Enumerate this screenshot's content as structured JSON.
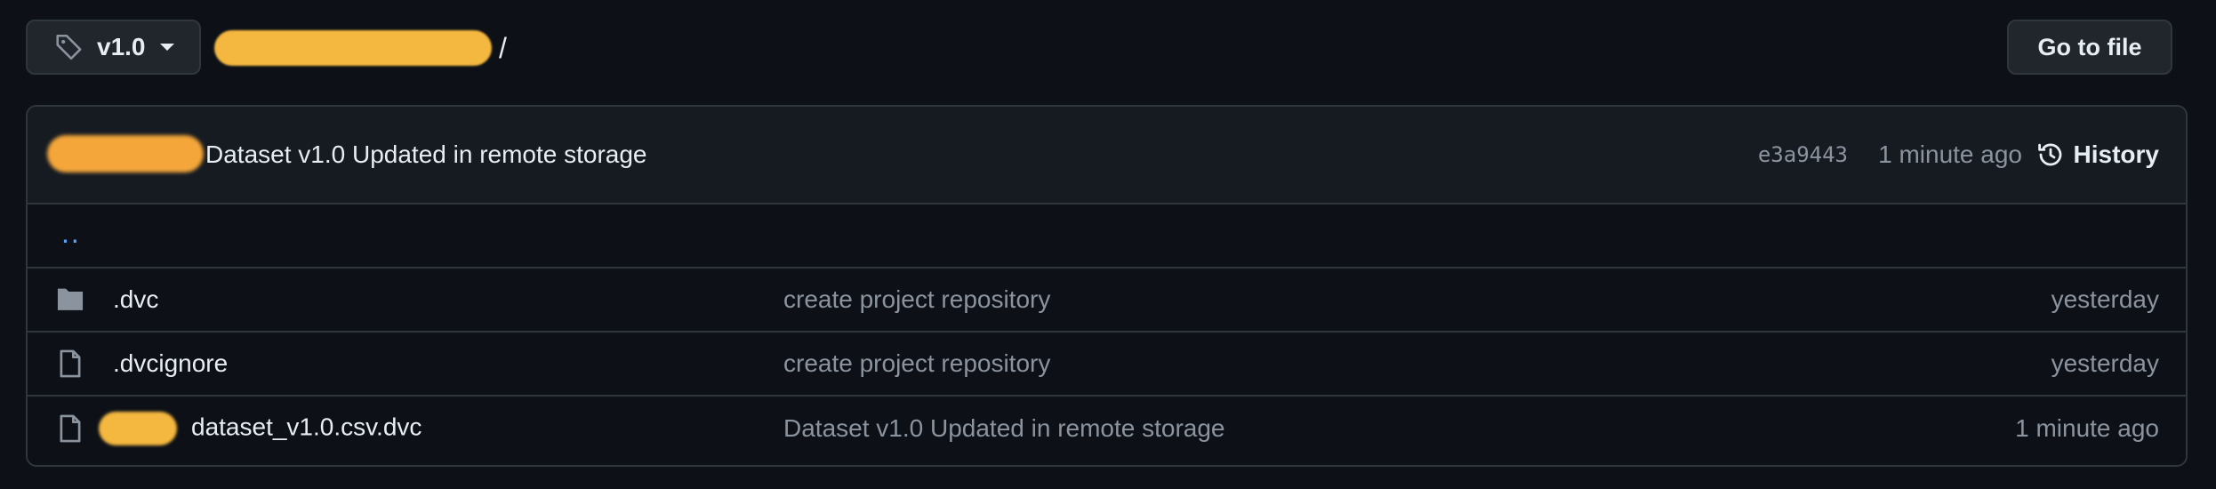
{
  "branch": {
    "label": "v1.0"
  },
  "path": {
    "separator": "/"
  },
  "goto_button": "Go to file",
  "latest_commit": {
    "message": "Dataset v1.0 Updated in remote storage",
    "sha": "e3a9443",
    "time": "1 minute ago",
    "history_label": "History"
  },
  "parent_link": "..",
  "files": [
    {
      "type": "folder",
      "name": ".dvc",
      "commit": "create project repository",
      "date": "yesterday"
    },
    {
      "type": "file",
      "name": ".dvcignore",
      "commit": "create project repository",
      "date": "yesterday"
    },
    {
      "type": "file",
      "name": "dataset_v1.0.csv.dvc",
      "commit": "Dataset v1.0 Updated in remote storage",
      "date": "1 minute ago"
    }
  ],
  "colors": {
    "background": "#0d1117",
    "border": "#30363d",
    "link": "#58a6ff",
    "muted": "#8b949e",
    "redaction": "#f4b73f"
  }
}
